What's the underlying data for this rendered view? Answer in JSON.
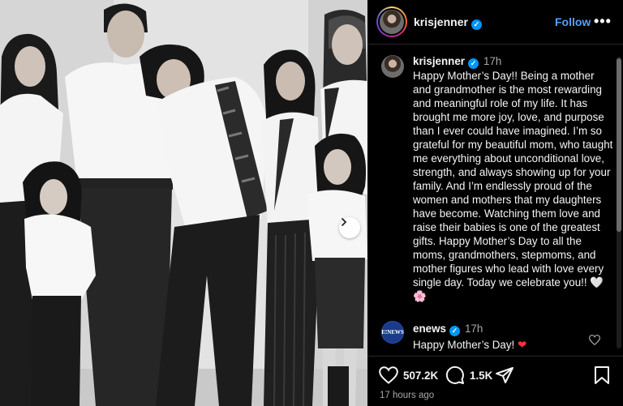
{
  "post": {
    "username": "krisjenner",
    "follow_label": "Follow",
    "more_label": "•••",
    "caption": {
      "username": "krisjenner",
      "time": "17h",
      "text": "Happy Mother’s Day!! Being a mother and grandmother is the most rewarding and meaningful role of my life. It has brought me more joy, love, and purpose than I ever could have imagined. I’m so grateful for my beautiful mom, who taught me everything about unconditional love, strength, and always showing up for your family. And I’m endlessly proud of the women and mothers that my daughters have become. Watching them love and raise their babies is one of the greatest gifts. Happy Mother’s Day to all the moms, grandmothers, stepmoms, and mother figures who lead with love every single day. Today we celebrate you!!",
      "emoji_heart": "🤍",
      "emoji_flower": "🌸"
    },
    "comments": [
      {
        "username": "enews",
        "time": "17h",
        "text": "Happy Mother’s Day!",
        "emoji": "❤",
        "avatar_label": "E!NEWS"
      }
    ],
    "likes": "507.2K",
    "comment_count": "1.5K",
    "posted": "17 hours ago"
  },
  "icons": {
    "verified": "verified-badge-icon",
    "heart": "heart-icon",
    "comment": "comment-icon",
    "share": "share-icon",
    "save": "bookmark-icon",
    "carousel": "chevron-right-icon"
  },
  "colors": {
    "background": "#000000",
    "follow": "#5b9ff8",
    "verified": "#0095f6",
    "muted": "#a8a8a8"
  }
}
